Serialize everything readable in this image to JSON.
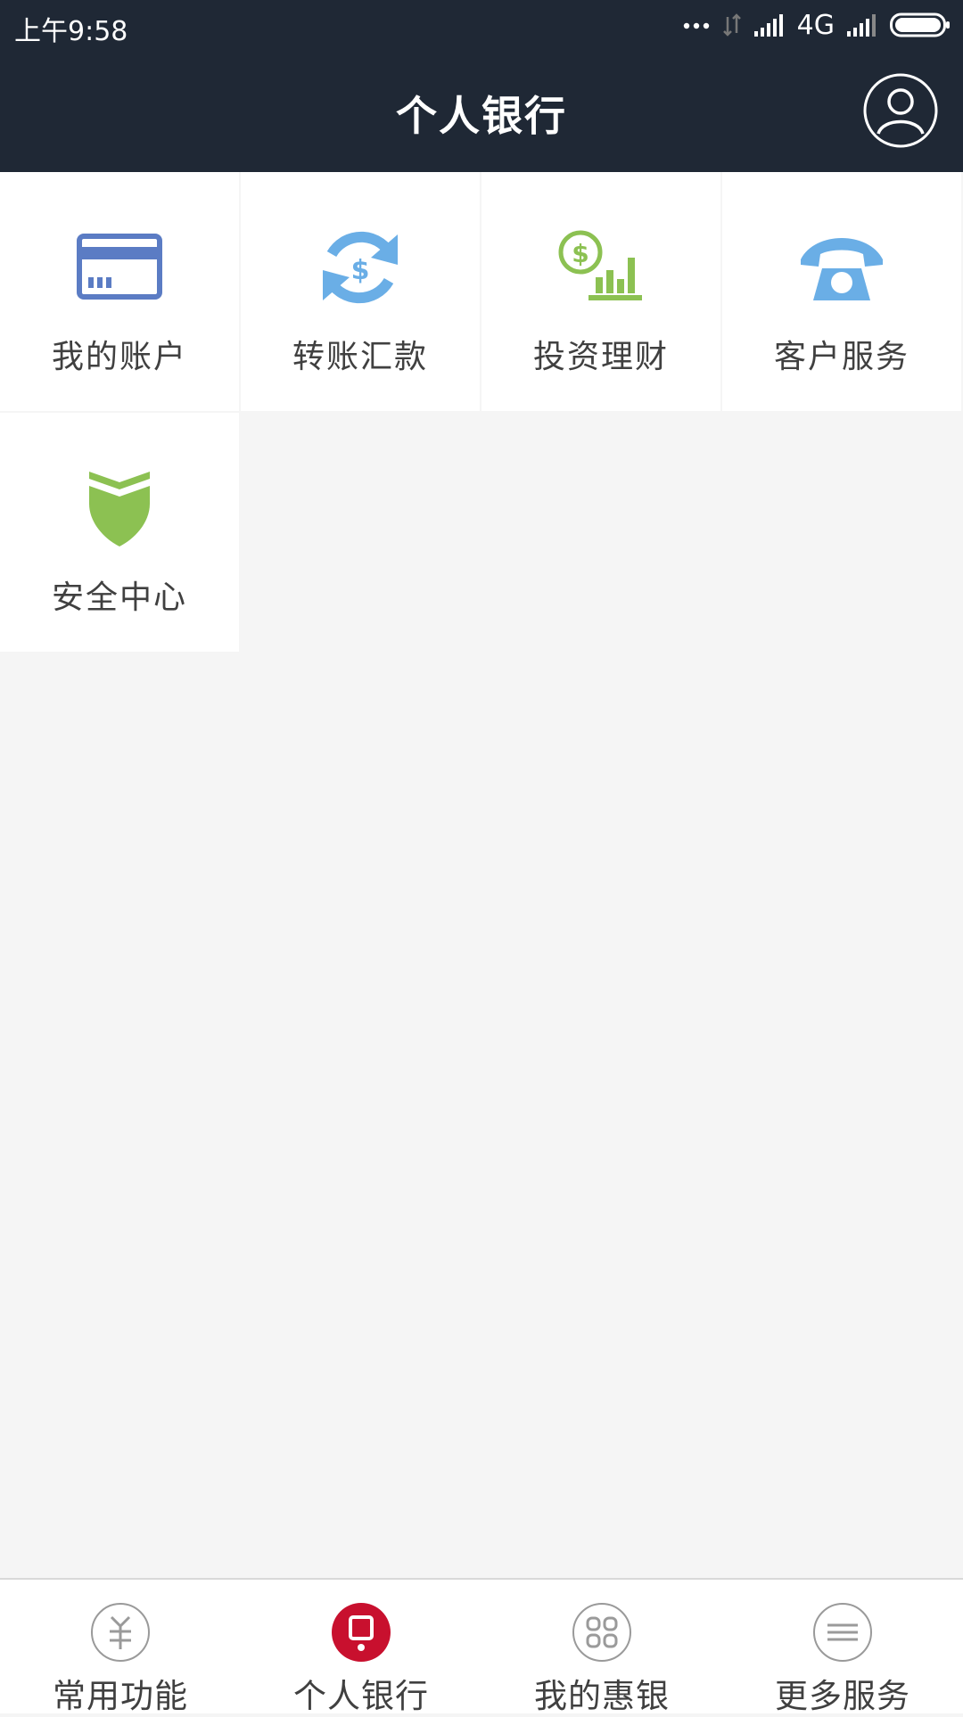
{
  "status_bar": {
    "time": "上午9:58",
    "network": "4G",
    "icons": [
      "more-dots-icon",
      "data-arrows-icon",
      "signal-icon",
      "signal-icon",
      "battery-icon"
    ]
  },
  "header": {
    "title": "个人银行",
    "profile_icon": "user-profile-icon"
  },
  "menu": {
    "items": [
      {
        "label": "我的账户",
        "icon": "bank-card-icon",
        "color": "#5b7cc4"
      },
      {
        "label": "转账汇款",
        "icon": "transfer-dollar-icon",
        "color": "#6aaee6"
      },
      {
        "label": "投资理财",
        "icon": "investment-chart-icon",
        "color": "#8cc152"
      },
      {
        "label": "客户服务",
        "icon": "telephone-icon",
        "color": "#6aaee6"
      },
      {
        "label": "安全中心",
        "icon": "shield-icon",
        "color": "#8cc152"
      }
    ]
  },
  "tab_bar": {
    "tabs": [
      {
        "label": "常用功能",
        "icon": "yuan-icon",
        "active": false
      },
      {
        "label": "个人银行",
        "icon": "personal-bank-icon",
        "active": true
      },
      {
        "label": "我的惠银",
        "icon": "grid-four-icon",
        "active": false
      },
      {
        "label": "更多服务",
        "icon": "menu-lines-icon",
        "active": false
      }
    ]
  },
  "colors": {
    "header_bg": "#1f2835",
    "page_bg": "#f5f5f5",
    "active_tab": "#c8102e",
    "inactive_icon": "#9a9a9a"
  }
}
